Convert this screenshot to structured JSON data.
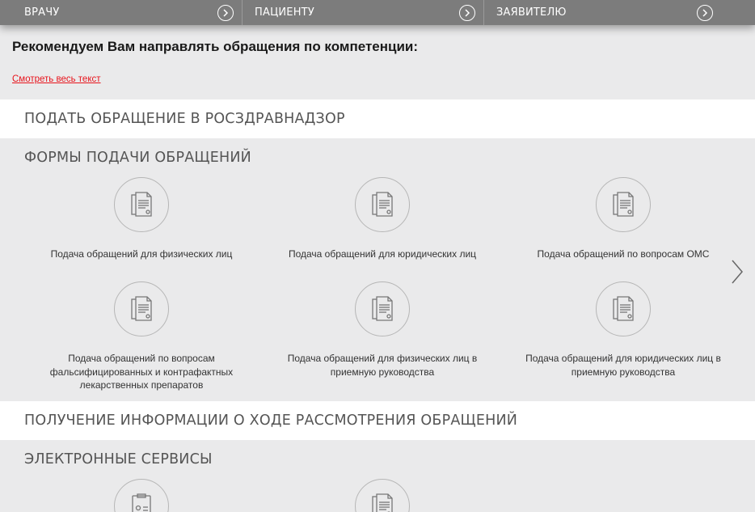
{
  "nav": {
    "items": [
      {
        "label": "ВРАЧУ",
        "icon": "chevron-right-circle-icon"
      },
      {
        "label": "ПАЦИЕНТУ",
        "icon": "chevron-right-circle-icon"
      },
      {
        "label": "ЗАЯВИТЕЛЮ",
        "icon": "chevron-right-circle-icon"
      }
    ]
  },
  "notice": {
    "text": "Рекомендуем Вам направлять обращения по компетенции:",
    "link": "Смотреть весь текст"
  },
  "sections": {
    "submit": "ПОДАТЬ ОБРАЩЕНИЕ В РОСЗДРАВНАДЗОР",
    "forms": "ФОРМЫ ПОДАЧИ ОБРАЩЕНИЙ",
    "status": "ПОЛУЧЕНИЕ ИНФОРМАЦИИ О ХОДЕ РАССМОТРЕНИЯ ОБРАЩЕНИЙ",
    "eservices": "ЭЛЕКТРОННЫЕ СЕРВИСЫ"
  },
  "forms": [
    {
      "label": "Подача обращений для физических лиц",
      "icon": "document-icon"
    },
    {
      "label": "Подача обращений для юридических лиц",
      "icon": "document-icon"
    },
    {
      "label": "Подача обращений по вопросам ОМС",
      "icon": "document-icon"
    },
    {
      "label": "Подача обращений по вопросам фальсифицированных и контрафактных лекарственных препаратов",
      "icon": "document-icon"
    },
    {
      "label": "Подача обращений для физических лиц в приемную руководства",
      "icon": "document-icon"
    },
    {
      "label": "Подача обращений для юридических лиц в приемную руководства",
      "icon": "document-icon"
    }
  ],
  "services": [
    {
      "icon": "id-card-icon"
    },
    {
      "icon": "document-icon"
    }
  ],
  "colors": {
    "nav_bg": "#7c7c7c",
    "page_bg": "#eaeaeb",
    "link": "#e8141c"
  }
}
